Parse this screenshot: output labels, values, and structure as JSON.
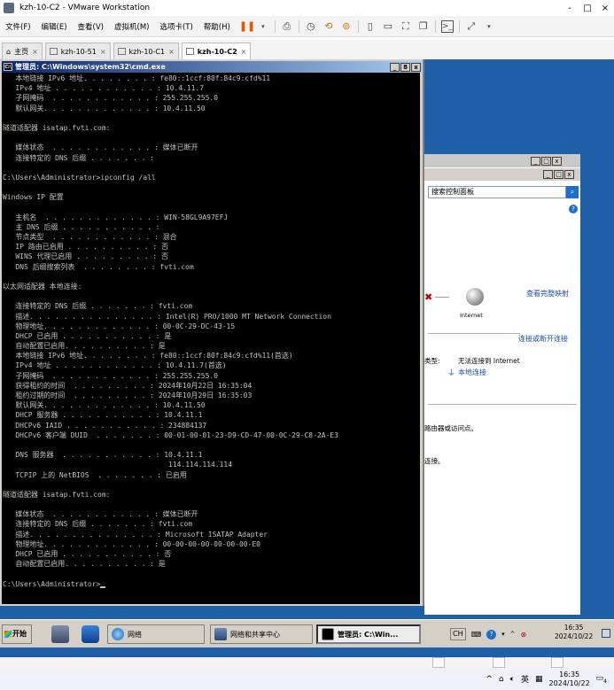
{
  "vmware": {
    "title": "kzh-10-C2 - VMware Workstation",
    "controls": [
      "-",
      "□",
      "×"
    ],
    "menu": [
      "文件(F)",
      "编辑(E)",
      "查看(V)",
      "虚拟机(M)",
      "选项卡(T)",
      "帮助(H)"
    ],
    "tabs": [
      {
        "label": "主页",
        "active": false
      },
      {
        "label": "kzh-10-51",
        "active": false
      },
      {
        "label": "kzh-10-C1",
        "active": false
      },
      {
        "label": "kzh-10-C2",
        "active": true
      }
    ],
    "tab_close": "×"
  },
  "cmd": {
    "title": "管理员: C:\\Windows\\system32\\cmd.exe",
    "controls": [
      "_",
      "8",
      "x"
    ],
    "lines": [
      "   本地链接 IPv6 地址. . . . . . . . : fe80::1ccf:80f:84c9:cfd%11",
      "   IPv4 地址 . . . . . . . . . . . . : 10.4.11.7",
      "   子网掩码  . . . . . . . . . . . . : 255.255.255.0",
      "   默认网关. . . . . . . . . . . . . : 10.4.11.50",
      "",
      "隧道适配器 isatap.fvti.com:",
      "",
      "   媒体状态  . . . . . . . . . . . . : 媒体已断开",
      "   连接特定的 DNS 后缀 . . . . . . . :",
      "",
      "C:\\Users\\Administrator>ipconfig /all",
      "",
      "Windows IP 配置",
      "",
      "   主机名  . . . . . . . . . . . . . : WIN-58GL9A97EFJ",
      "   主 DNS 后缀 . . . . . . . . . . . :",
      "   节点类型  . . . . . . . . . . . . : 混合",
      "   IP 路由已启用 . . . . . . . . . . : 否",
      "   WINS 代理已启用 . . . . . . . . . : 否",
      "   DNS 后缀搜索列表  . . . . . . . . : fvti.com",
      "",
      "以太网适配器 本地连接:",
      "",
      "   连接特定的 DNS 后缀 . . . . . . . : fvti.com",
      "   描述. . . . . . . . . . . . . . . : Intel(R) PRO/1000 MT Network Connection",
      "   物理地址. . . . . . . . . . . . . : 00-0C-29-DC-43-15",
      "   DHCP 已启用 . . . . . . . . . . . : 是",
      "   自动配置已启用. . . . . . . . . . : 是",
      "   本地链接 IPv6 地址. . . . . . . . : fe80::1ccf:80f:84c9:cfd%11(首选)",
      "   IPv4 地址 . . . . . . . . . . . . : 10.4.11.7(首选)",
      "   子网掩码  . . . . . . . . . . . . : 255.255.255.0",
      "   获得租约的时间  . . . . . . . . . : 2024年10月22日 16:35:04",
      "   租约过期的时间  . . . . . . . . . : 2024年10月29日 16:35:03",
      "   默认网关. . . . . . . . . . . . . : 10.4.11.50",
      "   DHCP 服务器 . . . . . . . . . . . : 10.4.11.1",
      "   DHCPv6 IAID . . . . . . . . . . . : 234884137",
      "   DHCPv6 客户端 DUID  . . . . . . . : 00-01-00-01-23-D9-CD-47-00-0C-29-C8-2A-E3",
      "",
      "   DNS 服务器  . . . . . . . . . . . : 10.4.11.1",
      "                                       114.114.114.114",
      "   TCPIP 上的 NetBIOS  . . . . . . . : 已启用",
      "",
      "隧道适配器 isatap.fvti.com:",
      "",
      "   媒体状态  . . . . . . . . . . . . : 媒体已断开",
      "   连接特定的 DNS 后缀 . . . . . . . : fvti.com",
      "   描述. . . . . . . . . . . . . . . : Microsoft ISATAP Adapter",
      "   物理地址. . . . . . . . . . . . . : 00-00-00-00-00-00-00-E0",
      "   DHCP 已启用 . . . . . . . . . . . : 否",
      "   自动配置已启用. . . . . . . . . . : 是",
      "",
      "C:\\Users\\Administrator>"
    ]
  },
  "network_window": {
    "controls": [
      "_",
      "□",
      "x"
    ],
    "search_placeholder": "搜索控制面板",
    "help": "?",
    "view_full_map": "查看完整映射",
    "internet_label": "Internet",
    "connect_disconnect": "连接或断开连接",
    "type_label": "类型:",
    "no_internet": "无法连接到 Internet",
    "local_connection": "本地连接",
    "router_text": "路由器或访问点。",
    "connect_text": "连接。"
  },
  "guest_taskbar": {
    "start": "开始",
    "tasks": [
      {
        "label": "网络",
        "active": false
      },
      {
        "label": "网络和共享中心",
        "active": false
      },
      {
        "label": "管理员: C:\\Win...",
        "active": true
      }
    ],
    "tray": [
      "CH",
      "?"
    ],
    "clock_time": "16:35",
    "clock_date": "2024/10/22"
  },
  "host": {
    "taskbar_ime": "英",
    "clock_time": "16:35",
    "clock_date": "2024/10/22",
    "notif_count": "4"
  }
}
